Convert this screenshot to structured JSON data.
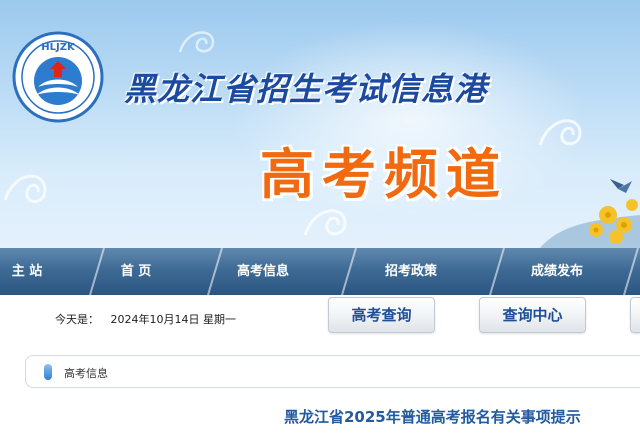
{
  "banner": {
    "logo_text": "HLJZK",
    "logo_ring_text": "黑龙江招生考试信息港",
    "site_title": "黑龙江省招生考试信息港",
    "channel_title": "高考频道"
  },
  "nav": {
    "items": [
      {
        "label": "主 站"
      },
      {
        "label": "首 页"
      },
      {
        "label": "高考信息"
      },
      {
        "label": "招考政策"
      },
      {
        "label": "成绩发布"
      }
    ]
  },
  "date_bar": {
    "label": "今天是：",
    "date": "2024年10月14日 星期一"
  },
  "buttons": {
    "gaokao_query": "高考查询",
    "query_center": "查询中心"
  },
  "breadcrumb": {
    "current": "高考信息"
  },
  "article": {
    "title": "黑龙江省2025年普通高考报名有关事项提示"
  },
  "colors": {
    "nav_bg": "#3e6b95",
    "channel_orange": "#f26a10",
    "title_blue": "#1c4aa0",
    "article_blue": "#235b9e"
  }
}
